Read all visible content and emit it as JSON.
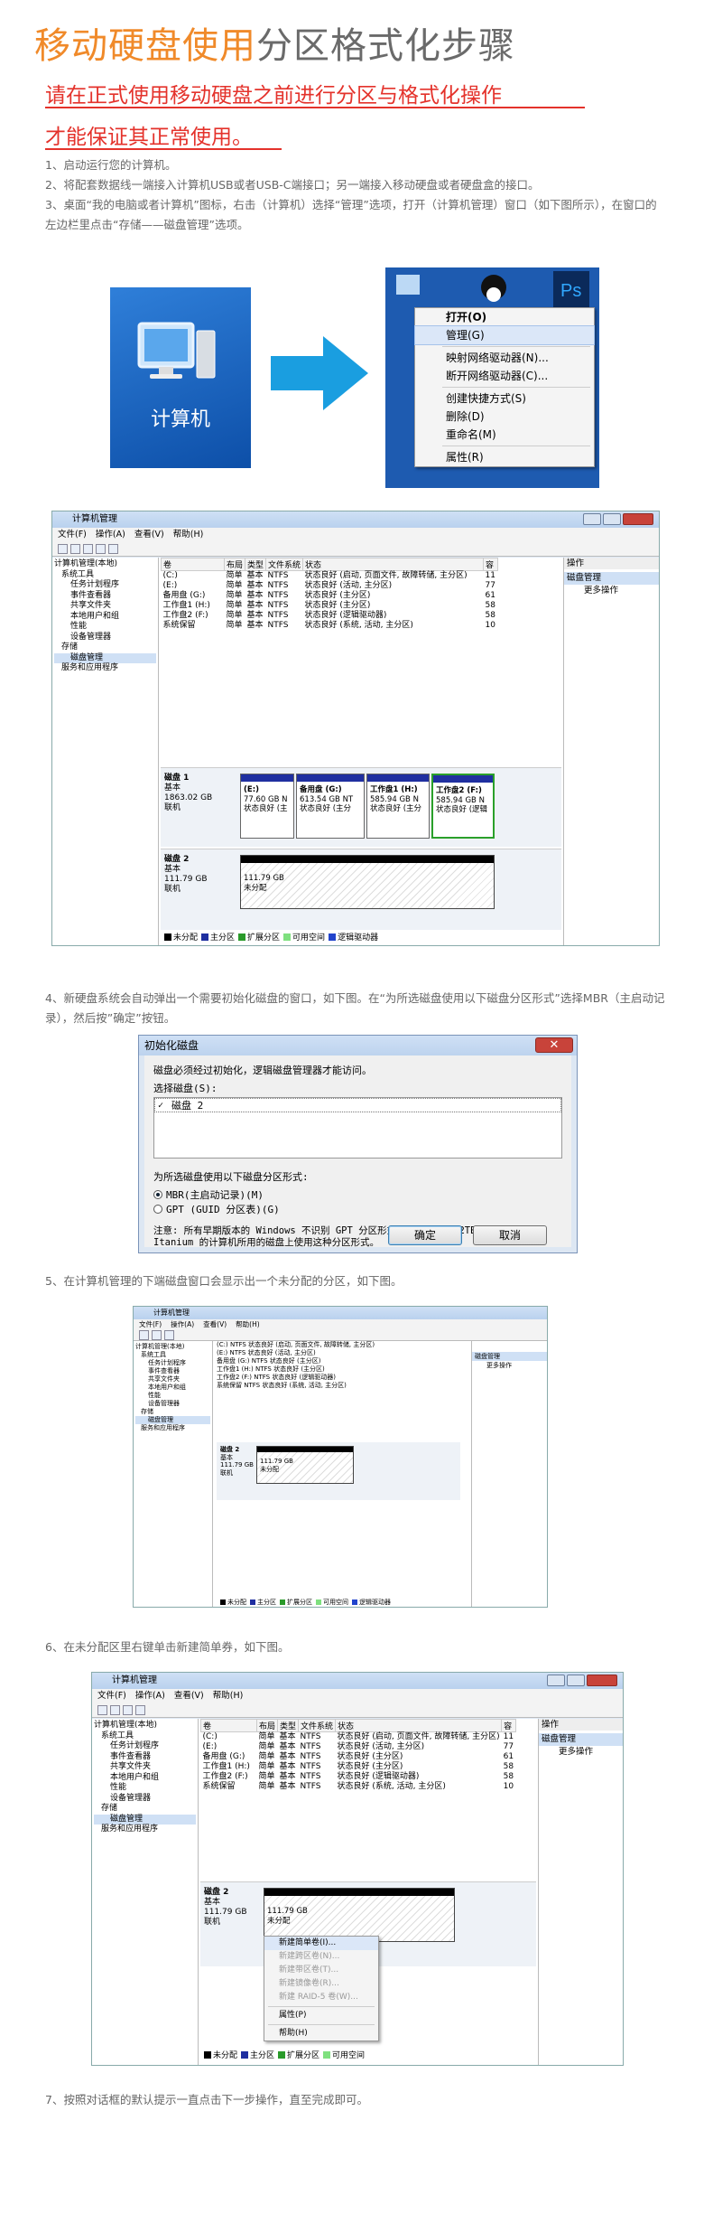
{
  "title": {
    "part1": "移动硬盘使用",
    "part2": "分区格式化步骤"
  },
  "warning": {
    "line1": "请在正式使用移动硬盘之前进行分区与格式化操作",
    "line2": "才能保证其正常使用。"
  },
  "steps": {
    "s1": "1、启动运行您的计算机。",
    "s2": "2、将配套数据线一端接入计算机USB或者USB-C端接口；另一端接入移动硬盘或者硬盘盒的接口。",
    "s3": "3、桌面“我的电脑或者计算机”图标，右击（计算机）选择“管理”选项，打开（计算机管理）窗口（如下图所示），在窗口的左边栏里点击“存储——磁盘管理”选项。",
    "s4": "4、新硬盘系统会自动弹出一个需要初始化磁盘的窗口，如下图。在“为所选磁盘使用以下磁盘分区形式”选择MBR（主启动记录），然后按”确定”按钮。",
    "s5": "5、在计算机管理的下端磁盘窗口会显示出一个未分配的分区，如下图。",
    "s6": "6、在未分配区里右键单击新建简单券，如下图。",
    "s7": "7、按照对话框的默认提示一直点击下一步操作，直至完成即可。"
  },
  "desktop_icon": {
    "label": "计算机"
  },
  "context_menu": {
    "items": [
      "打开(O)",
      "管理(G)",
      "映射网络驱动器(N)...",
      "断开网络驱动器(C)...",
      "创建快捷方式(S)",
      "删除(D)",
      "重命名(M)",
      "属性(R)"
    ]
  },
  "cm": {
    "title": "计算机管理",
    "menu": [
      "文件(F)",
      "操作(A)",
      "查看(V)",
      "帮助(H)"
    ],
    "tree": [
      "计算机管理(本地)",
      "系统工具",
      "任务计划程序",
      "事件查看器",
      "共享文件夹",
      "本地用户和组",
      "性能",
      "设备管理器",
      "存储",
      "磁盘管理",
      "服务和应用程序"
    ],
    "columns": [
      "卷",
      "布局",
      "类型",
      "文件系统",
      "状态",
      "容"
    ],
    "rows": [
      [
        "(C:)",
        "简单",
        "基本",
        "NTFS",
        "状态良好 (启动, 页面文件, 故障转储, 主分区)",
        "11"
      ],
      [
        "(E:)",
        "简单",
        "基本",
        "NTFS",
        "状态良好 (活动, 主分区)",
        "77"
      ],
      [
        "备用盘 (G:)",
        "简单",
        "基本",
        "NTFS",
        "状态良好 (主分区)",
        "61"
      ],
      [
        "工作盘1 (H:)",
        "简单",
        "基本",
        "NTFS",
        "状态良好 (主分区)",
        "58"
      ],
      [
        "工作盘2 (F:)",
        "简单",
        "基本",
        "NTFS",
        "状态良好 (逻辑驱动器)",
        "58"
      ],
      [
        "系统保留",
        "简单",
        "基本",
        "NTFS",
        "状态良好 (系统, 活动, 主分区)",
        "10"
      ]
    ],
    "actions": {
      "header": "操作",
      "group": "磁盘管理",
      "more": "更多操作"
    },
    "disk1": {
      "name": "磁盘 1",
      "type": "基本",
      "size": "1863.02 GB",
      "status": "联机",
      "parts": [
        {
          "name": "(E:)",
          "size": "77.60 GB N",
          "status": "状态良好 (主"
        },
        {
          "name": "备用盘 (G:)",
          "size": "613.54 GB NT",
          "status": "状态良好 (主分"
        },
        {
          "name": "工作盘1 (H:)",
          "size": "585.94 GB N",
          "status": "状态良好 (主分"
        },
        {
          "name": "工作盘2 (F:)",
          "size": "585.94 GB N",
          "status": "状态良好 (逻辑"
        }
      ]
    },
    "disk2": {
      "name": "磁盘 2",
      "type": "基本",
      "size": "111.79 GB",
      "status": "联机",
      "part_size": "111.79 GB",
      "part_label": "未分配"
    },
    "legend": [
      "未分配",
      "主分区",
      "扩展分区",
      "可用空间",
      "逻辑驱动器"
    ]
  },
  "init_dialog": {
    "title": "初始化磁盘",
    "intro": "磁盘必须经过初始化，逻辑磁盘管理器才能访问。",
    "select_label": "选择磁盘(S):",
    "disk_item": "磁盘 2",
    "style_label": "为所选磁盘使用以下磁盘分区形式:",
    "opt_mbr": "MBR(主启动记录)(M)",
    "opt_gpt": "GPT (GUID 分区表)(G)",
    "note": "注意: 所有早期版本的 Windows 不识别 GPT 分区形式。建议在大于 2TB 的磁盘或基于 Itanium 的计算机所用的磁盘上使用这种分区形式。",
    "ok": "确定",
    "cancel": "取消"
  },
  "right_menu": {
    "items": [
      "新建简单卷(I)...",
      "新建跨区卷(N)...",
      "新建带区卷(T)...",
      "新建镜像卷(R)...",
      "新建 RAID-5 卷(W)...",
      "属性(P)",
      "帮助(H)"
    ]
  },
  "colors": {
    "orange": "#f08a2a",
    "red": "#e4322b",
    "win_blue": "#1565c0"
  }
}
